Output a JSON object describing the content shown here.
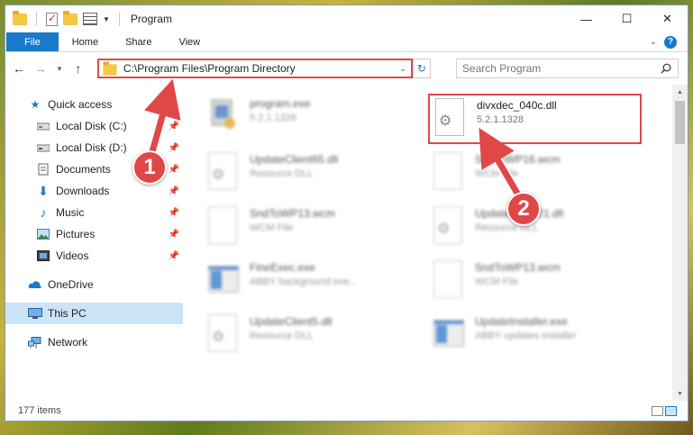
{
  "window": {
    "title": "Program",
    "controls": {
      "minimize": "—",
      "maximize": "☐",
      "close": "✕"
    }
  },
  "ribbon": {
    "tabs": [
      "File",
      "Home",
      "Share",
      "View"
    ],
    "help_icon": "?"
  },
  "address": {
    "path": "C:\\Program Files\\Program Directory",
    "search_placeholder": "Search Program"
  },
  "sidebar": {
    "items": [
      {
        "label": "Quick access",
        "icon": "star-icon"
      },
      {
        "label": "Local Disk (C:)",
        "icon": "drive-icon",
        "pinned": true
      },
      {
        "label": "Local Disk (D:)",
        "icon": "drive-icon",
        "pinned": true
      },
      {
        "label": "Documents",
        "icon": "documents-icon",
        "pinned": true
      },
      {
        "label": "Downloads",
        "icon": "downloads-icon",
        "pinned": true
      },
      {
        "label": "Music",
        "icon": "music-icon",
        "pinned": true
      },
      {
        "label": "Pictures",
        "icon": "pictures-icon",
        "pinned": true
      },
      {
        "label": "Videos",
        "icon": "videos-icon",
        "pinned": true
      },
      {
        "label": "OneDrive",
        "icon": "cloud-icon"
      },
      {
        "label": "This PC",
        "icon": "computer-icon",
        "selected": true
      },
      {
        "label": "Network",
        "icon": "network-icon"
      }
    ]
  },
  "files": [
    {
      "name": "program.exe",
      "sub": "5.2.1.1328",
      "icon": "installer-icon",
      "blurred": true
    },
    {
      "name": "divxdec_040c.dll",
      "sub": "5.2.1.1328",
      "icon": "dll-gear-icon",
      "blurred": false,
      "highlighted": true
    },
    {
      "name": "UpdateClient65.dll",
      "sub": "Resource DLL",
      "icon": "dll-gear-icon",
      "blurred": true
    },
    {
      "name": "SndToWP16.wcm",
      "sub": "WCM File",
      "icon": "file-icon",
      "blurred": true
    },
    {
      "name": "SndToWP13.wcm",
      "sub": "WCM File",
      "icon": "file-icon",
      "blurred": true
    },
    {
      "name": "UpdateClient21.dll",
      "sub": "Resource DLL",
      "icon": "dll-gear-icon",
      "blurred": true
    },
    {
      "name": "FineExec.exe",
      "sub": "ABBY background exe...",
      "icon": "app-icon",
      "blurred": true
    },
    {
      "name": "SndToWP13.wcm",
      "sub": "WCM File",
      "icon": "file-icon",
      "blurred": true
    },
    {
      "name": "UpdateClient5.dll",
      "sub": "Resource DLL",
      "icon": "dll-gear-icon",
      "blurred": true
    },
    {
      "name": "UpdateInstaller.exe",
      "sub": "ABBY updates installer",
      "icon": "app-icon",
      "blurred": true
    }
  ],
  "status": {
    "items_count": "177 items"
  },
  "callouts": [
    {
      "number": "1",
      "target": "address-bar"
    },
    {
      "number": "2",
      "target": "file-divxdec"
    }
  ],
  "colors": {
    "accent": "#1979ca",
    "callout": "#e04848",
    "selected": "#cce4f7"
  }
}
